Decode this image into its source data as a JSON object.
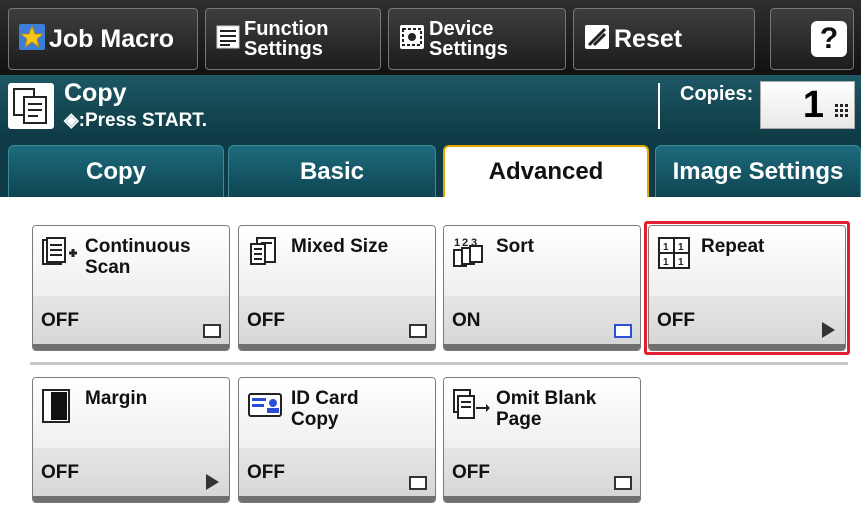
{
  "toolbar": {
    "job_macro": "Job Macro",
    "function_settings_line1": "Function",
    "function_settings_line2": "Settings",
    "device_settings_line1": "Device",
    "device_settings_line2": "Settings",
    "reset": "Reset",
    "help": "?"
  },
  "status": {
    "mode": "Copy",
    "message": "◈:Press START.",
    "copies_label": "Copies:",
    "copies_value": "1"
  },
  "tabs": [
    {
      "label": "Copy",
      "active": false
    },
    {
      "label": "Basic",
      "active": false
    },
    {
      "label": "Advanced",
      "active": true
    },
    {
      "label": "Image Settings",
      "active": false
    }
  ],
  "functions": [
    {
      "title_line1": "Continuous",
      "title_line2": "Scan",
      "value": "OFF",
      "icon": "continuous-scan-icon",
      "indicator": "square"
    },
    {
      "title_line1": "Mixed Size",
      "title_line2": "",
      "value": "OFF",
      "icon": "mixed-size-icon",
      "indicator": "square"
    },
    {
      "title_line1": "Sort",
      "title_line2": "",
      "value": "ON",
      "icon": "sort-icon",
      "indicator": "square-blue"
    },
    {
      "title_line1": "Repeat",
      "title_line2": "",
      "value": "OFF",
      "icon": "repeat-icon",
      "indicator": "arrow",
      "highlighted": true
    },
    {
      "title_line1": "Margin",
      "title_line2": "",
      "value": "OFF",
      "icon": "margin-icon",
      "indicator": "arrow"
    },
    {
      "title_line1": "ID Card",
      "title_line2": "Copy",
      "value": "OFF",
      "icon": "id-card-icon",
      "indicator": "square"
    },
    {
      "title_line1": "Omit Blank",
      "title_line2": "Page",
      "value": "OFF",
      "icon": "omit-blank-page-icon",
      "indicator": "square"
    }
  ],
  "colors": {
    "toolbar_bg": "#1f1f1f",
    "status_bg": "#16495a",
    "tab_active_border": "#e3a800",
    "highlight": "#e21d2e",
    "on_indicator": "#2a4fd6"
  }
}
